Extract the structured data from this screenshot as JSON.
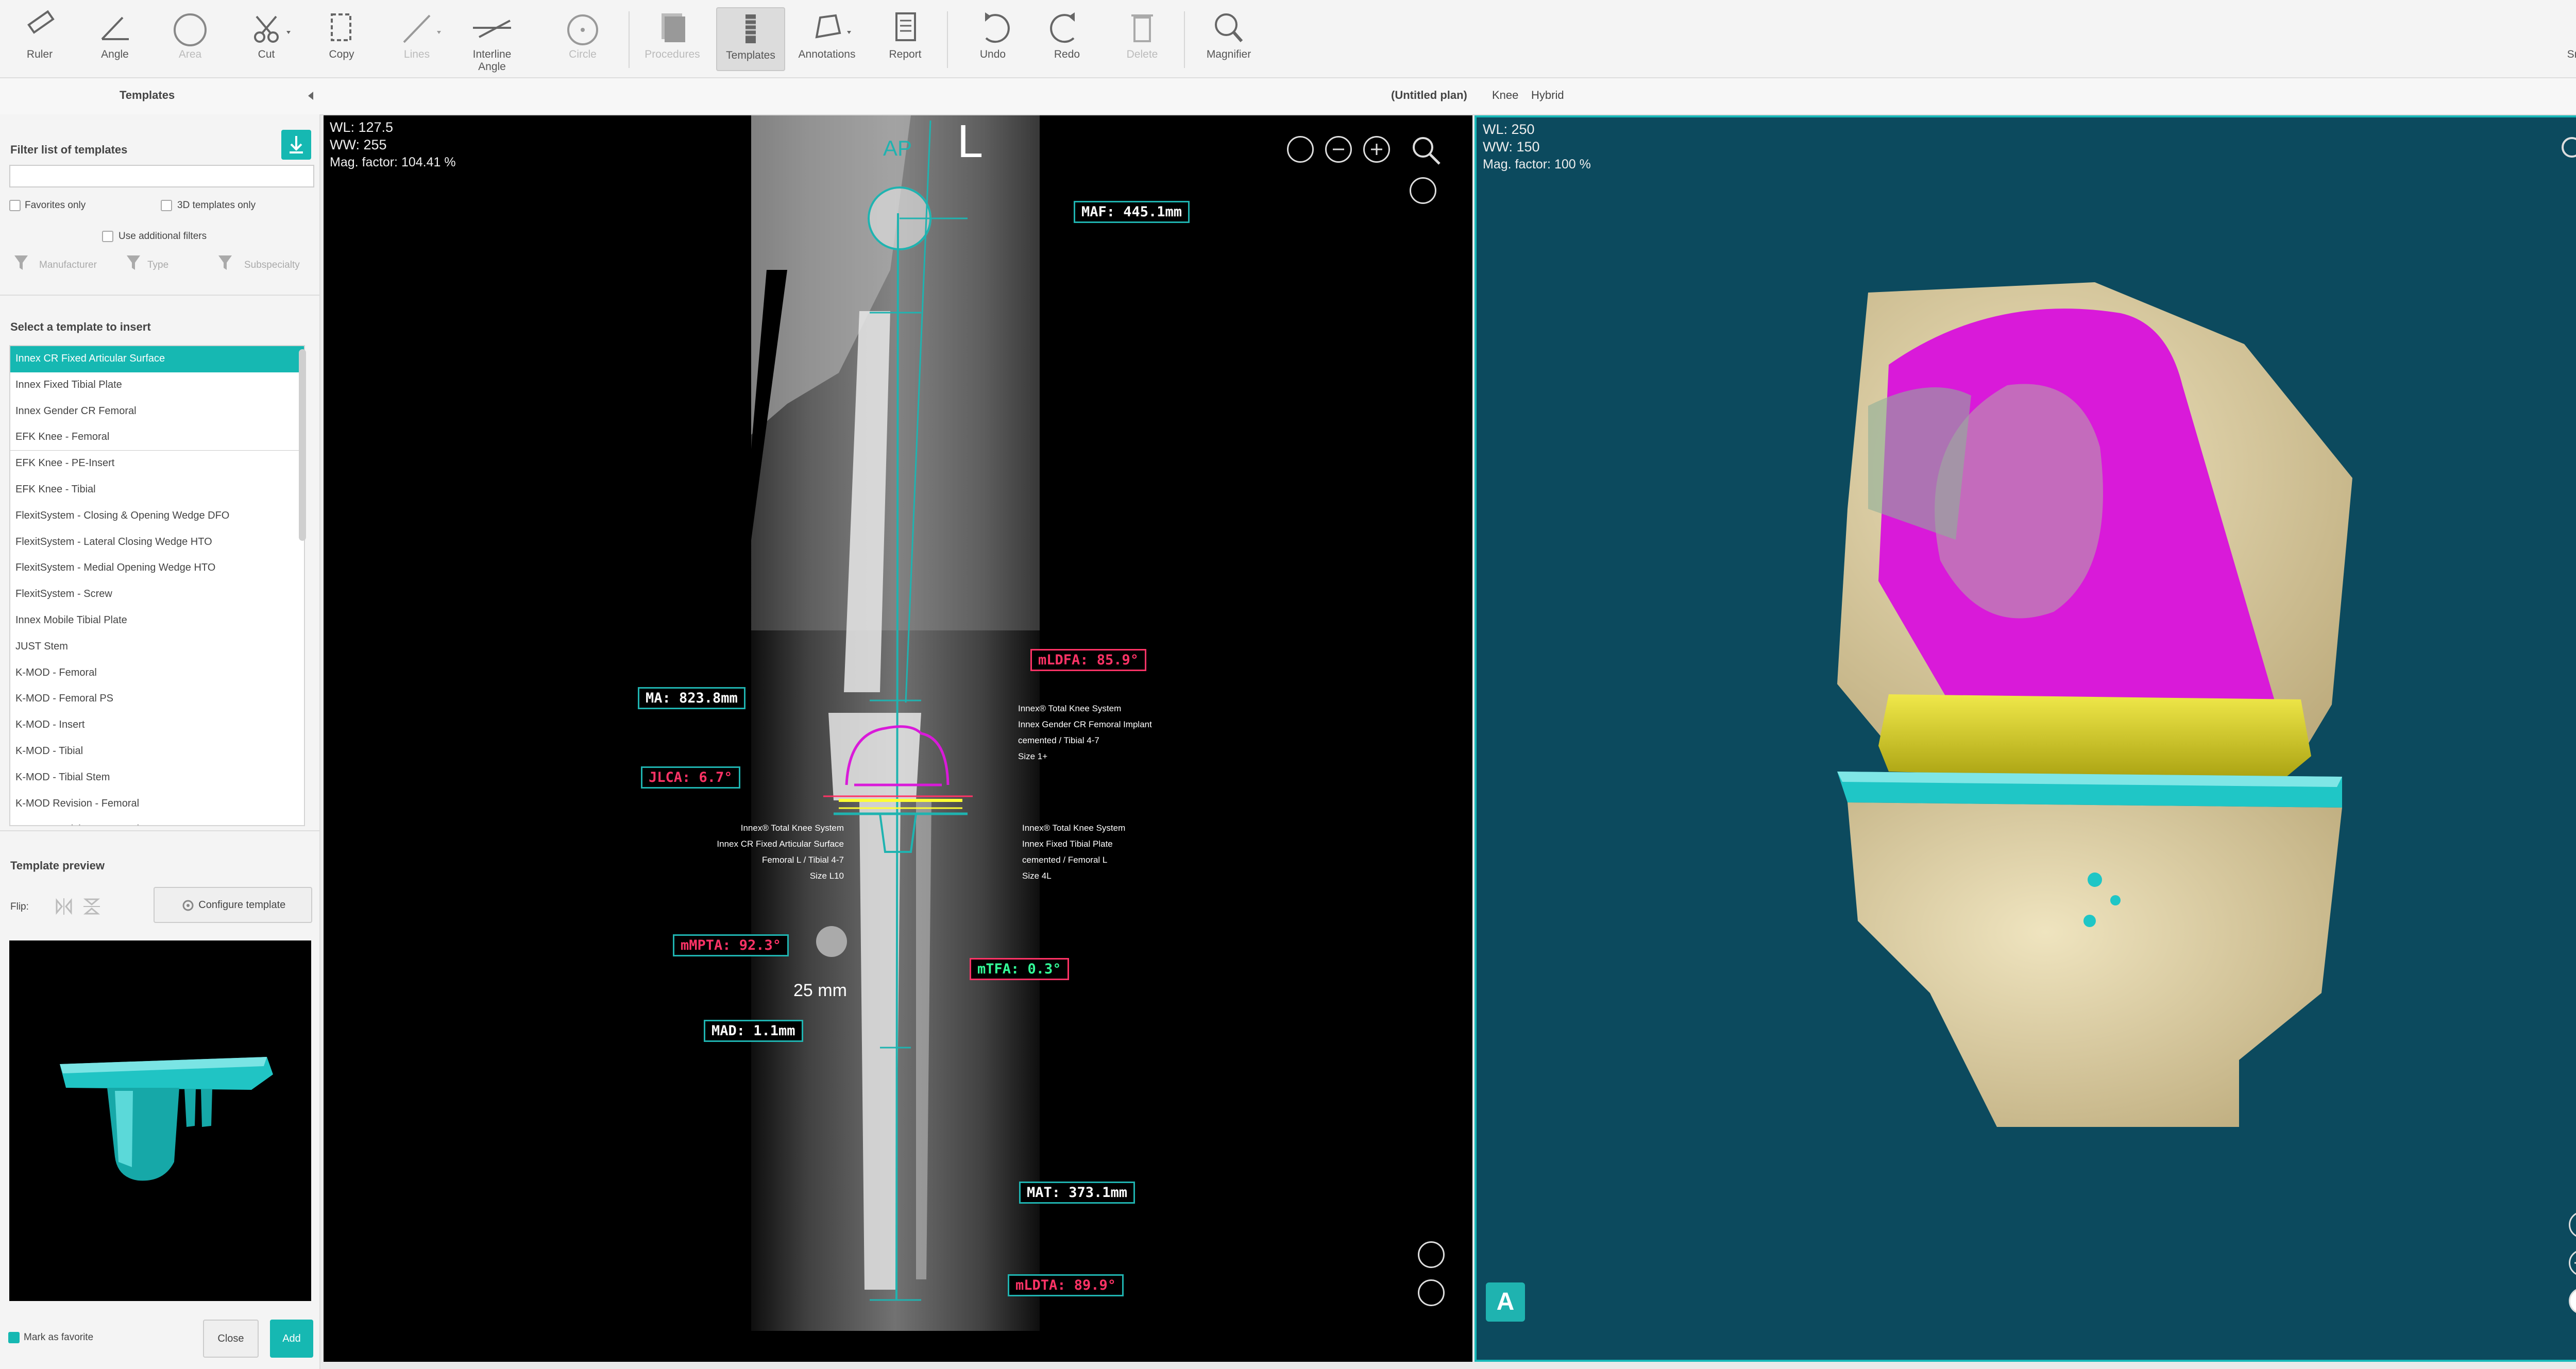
{
  "toolbar": {
    "ruler": "Ruler",
    "angle": "Angle",
    "area": "Area",
    "cut": "Cut",
    "copy": "Copy",
    "lines": "Lines",
    "interline_angle": "Interline Angle",
    "circle": "Circle",
    "procedures": "Procedures",
    "templates": "Templates",
    "annotations": "Annotations",
    "report": "Report",
    "undo": "Undo",
    "redo": "Redo",
    "delete": "Delete",
    "magnifier": "Magnifier",
    "snapshot": "Snapshot"
  },
  "subheader": {
    "plan": "(Untitled plan)",
    "knee": "Knee",
    "hybrid": "Hybrid"
  },
  "templates_panel": {
    "title": "Templates",
    "filter_label": "Filter list of templates",
    "filter_value": "",
    "favorites_only": "Favorites only",
    "templates_3d_only": "3D templates only",
    "use_additional_filters": "Use additional filters",
    "manufacturer": "Manufacturer",
    "type": "Type",
    "subspecialty": "Subspecialty",
    "select_label": "Select a template to insert",
    "items": [
      "Innex CR Fixed Articular Surface",
      "Innex Fixed Tibial Plate",
      "Innex Gender CR Femoral",
      "EFK Knee - Femoral",
      "EFK Knee - PE-Insert",
      "EFK Knee - Tibial",
      "FlexitSystem - Closing & Opening Wedge DFO",
      "FlexitSystem - Lateral Closing Wedge HTO",
      "FlexitSystem - Medial Opening Wedge HTO",
      "FlexitSystem - Screw",
      "Innex Mobile Tibial Plate",
      "JUST Stem",
      "K-MOD - Femoral",
      "K-MOD - Femoral PS",
      "K-MOD - Insert",
      "K-MOD - Tibial",
      "K-MOD - Tibial Stem",
      "K-MOD Revision - Femoral",
      "K-MOD Revision - Femoral Stem"
    ],
    "preview_label": "Template preview",
    "flip_label": "Flip:",
    "configure": "Configure template",
    "mark_favorite": "Mark as favorite",
    "close": "Close",
    "add": "Add"
  },
  "xray": {
    "wl": "WL: 127.5",
    "ww": "WW: 255",
    "mag": "Mag. factor: 104.41 %",
    "side_marker": "L",
    "ap_marker": "AP",
    "scale": "25 mm",
    "measurements": {
      "maf": "MAF: 445.1mm",
      "mldfa": "mLDFA: 85.9°",
      "ma": "MA: 823.8mm",
      "jlca": "JLCA: 6.7°",
      "mmpta": "mMPTA: 92.3°",
      "mtfa": "mTFA: 0.3°",
      "mad": "MAD: 1.1mm",
      "mat": "MAT: 373.1mm",
      "mldta": "mLDTA: 89.9°"
    },
    "note_femoral": [
      "Innex® Total Knee System",
      "Innex Gender CR Femoral Implant",
      "cemented / Tibial 4-7",
      "Size 1+"
    ],
    "note_articular": [
      "Innex® Total Knee System",
      "Innex CR Fixed Articular Surface",
      "Femoral L / Tibial 4-7",
      "Size L10"
    ],
    "note_tibial": [
      "Innex® Total Knee System",
      "Innex Fixed Tibial Plate",
      "cemented / Femoral L",
      "Size 4L"
    ]
  },
  "view3d": {
    "wl": "WL: 250",
    "ww": "WW: 150",
    "mag": "Mag. factor: 100 %",
    "badge": "A"
  },
  "colors": {
    "accent": "#16b8b2",
    "femoral_implant": "#d91ad9",
    "insert": "#d8d01a",
    "tibial_plate": "#1fc6c6",
    "bone": "#e8dcb0",
    "view_bg": "#0c4a5e"
  }
}
